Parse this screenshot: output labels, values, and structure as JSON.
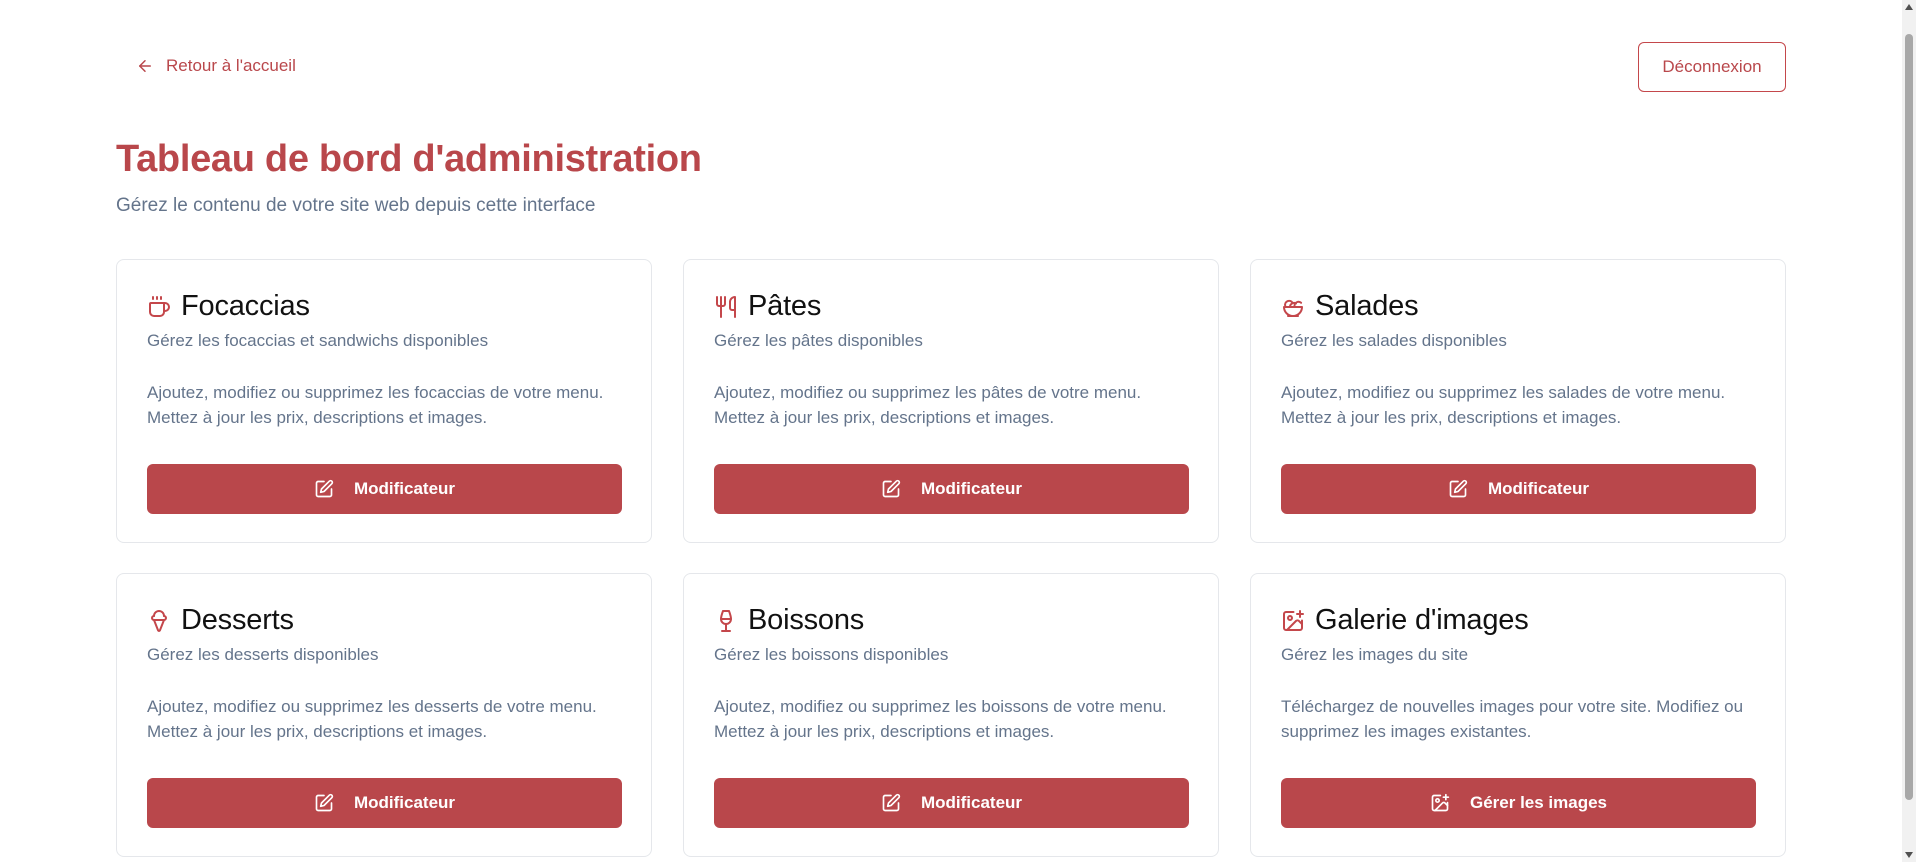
{
  "header": {
    "back_label": "Retour à l'accueil",
    "logout_label": "Déconnexion"
  },
  "page": {
    "title": "Tableau de bord d'administration",
    "subtitle": "Gérez le contenu de votre site web depuis cette interface"
  },
  "cards": [
    {
      "icon": "coffee-icon",
      "title": "Focaccias",
      "subtitle": "Gérez les focaccias et sandwichs disponibles",
      "description": "Ajoutez, modifiez ou supprimez les focaccias de votre menu. Mettez à jour les prix, descriptions et images.",
      "button_icon": "edit-icon",
      "button_label": "Modificateur"
    },
    {
      "icon": "utensils-icon",
      "title": "Pâtes",
      "subtitle": "Gérez les pâtes disponibles",
      "description": "Ajoutez, modifiez ou supprimez les pâtes de votre menu. Mettez à jour les prix, descriptions et images.",
      "button_icon": "edit-icon",
      "button_label": "Modificateur"
    },
    {
      "icon": "salad-icon",
      "title": "Salades",
      "subtitle": "Gérez les salades disponibles",
      "description": "Ajoutez, modifiez ou supprimez les salades de votre menu. Mettez à jour les prix, descriptions et images.",
      "button_icon": "edit-icon",
      "button_label": "Modificateur"
    },
    {
      "icon": "ice-cream-icon",
      "title": "Desserts",
      "subtitle": "Gérez les desserts disponibles",
      "description": "Ajoutez, modifiez ou supprimez les desserts de votre menu. Mettez à jour les prix, descriptions et images.",
      "button_icon": "edit-icon",
      "button_label": "Modificateur"
    },
    {
      "icon": "wine-icon",
      "title": "Boissons",
      "subtitle": "Gérez les boissons disponibles",
      "description": "Ajoutez, modifiez ou supprimez les boissons de votre menu. Mettez à jour les prix, descriptions et images.",
      "button_icon": "edit-icon",
      "button_label": "Modificateur"
    },
    {
      "icon": "image-plus-icon",
      "title": "Galerie d'images",
      "subtitle": "Gérez les images du site",
      "description": "Téléchargez de nouvelles images pour votre site. Modifiez ou supprimez les images existantes.",
      "button_icon": "image-plus-icon",
      "button_label": "Gérer les images"
    }
  ],
  "colors": {
    "accent": "#b9474b",
    "muted_text": "#64748b",
    "border": "#e5e7eb"
  }
}
